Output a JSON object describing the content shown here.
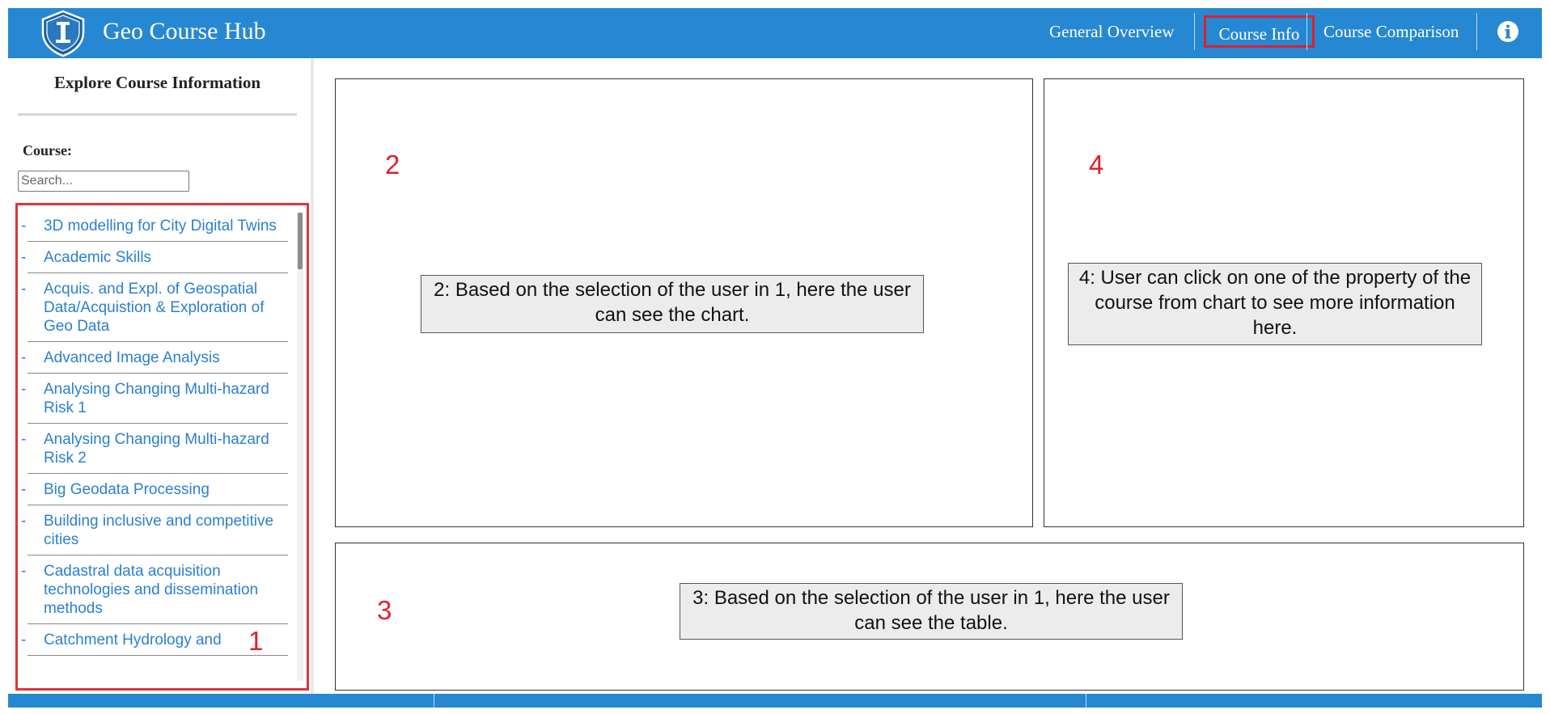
{
  "app": {
    "brand": "Geo Course Hub",
    "colors": {
      "navbar": "#2688d2",
      "link": "#2b7fd1",
      "highlight": "#e0202a"
    }
  },
  "nav": {
    "items": [
      {
        "label": "General Overview",
        "active": false
      },
      {
        "label": "Course Info",
        "active": true
      },
      {
        "label": "Course Comparison",
        "active": false
      }
    ],
    "info_icon": "info-circle-icon",
    "logo_icon": "shield-logo-icon"
  },
  "sidebar": {
    "title": "Explore Course Information",
    "course_label": "Course:",
    "search_placeholder": "Search...",
    "courses": [
      "3D modelling for City Digital Twins",
      "Academic Skills",
      "Acquis. and Expl. of Geospatial Data/Acquistion & Exploration of Geo Data",
      "Advanced Image Analysis",
      "Analysing Changing Multi-hazard Risk 1",
      "Analysing Changing Multi-hazard Risk 2",
      "Big Geodata Processing",
      "Building inclusive and competitive cities",
      "Cadastral data acquisition technologies and dissemination methods",
      "Catchment Hydrology and"
    ]
  },
  "annotations": {
    "marker_1": "1",
    "marker_2": "2",
    "marker_3": "3",
    "marker_4": "4",
    "callout_chart": "2: Based on the selection of the user in 1, here the user can see the chart.",
    "callout_detail": "4: User can click on one of the property of the course from chart to see more information here.",
    "callout_table": "3: Based on the selection of the user in 1, here the user can see the table."
  }
}
